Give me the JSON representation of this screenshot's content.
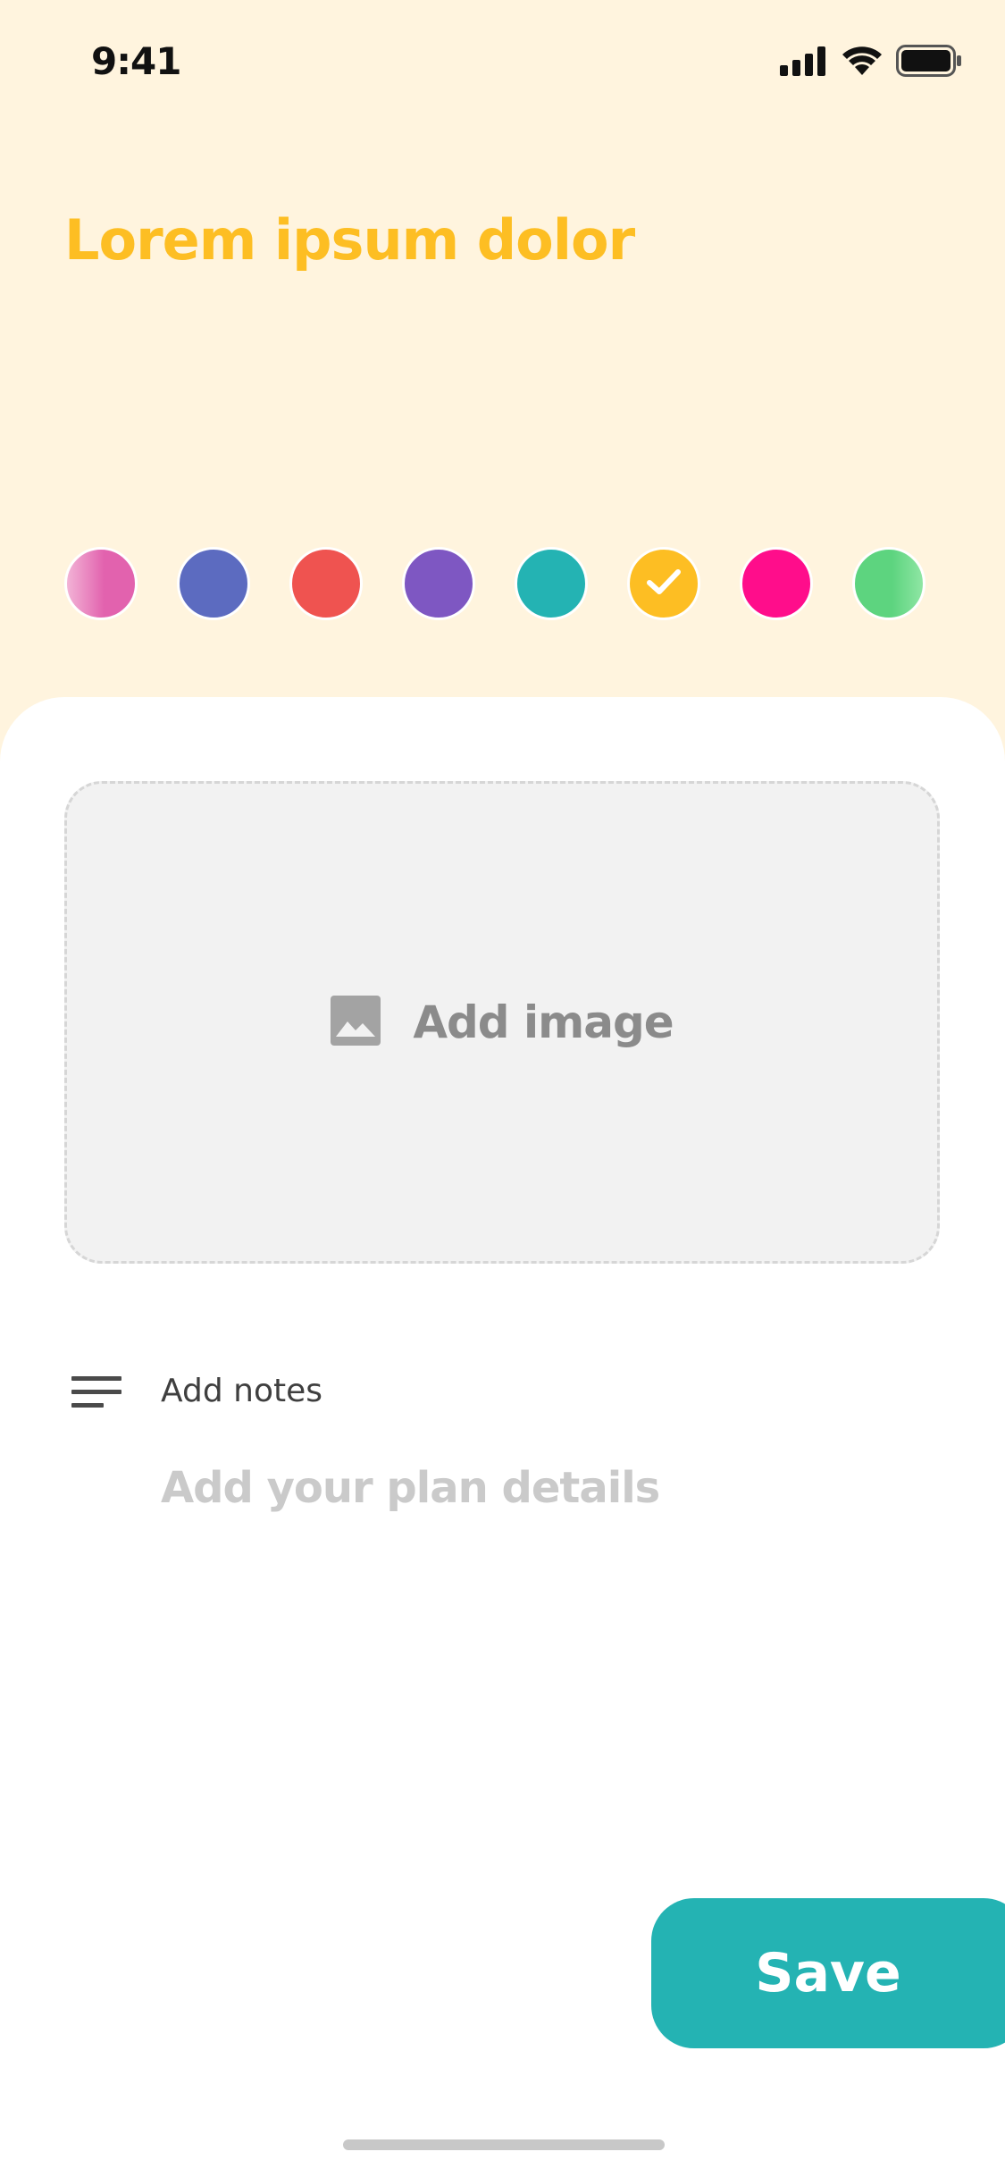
{
  "status_bar": {
    "time": "9:41",
    "signal_icon": "cellular-signal-icon",
    "wifi_icon": "wifi-icon",
    "battery_icon": "battery-icon"
  },
  "header": {
    "title": "Lorem ipsum dolor"
  },
  "color_picker": {
    "selected_index": 5,
    "swatches": [
      {
        "name": "pink",
        "color": "#E262AE",
        "highlight": "#F2B3D6"
      },
      {
        "name": "indigo",
        "color": "#5C6BC0"
      },
      {
        "name": "red",
        "color": "#EF5350"
      },
      {
        "name": "purple",
        "color": "#7E57C2"
      },
      {
        "name": "teal",
        "color": "#24B3B3"
      },
      {
        "name": "amber",
        "color": "#FDBE23"
      },
      {
        "name": "magenta",
        "color": "#FF0D8B"
      },
      {
        "name": "green",
        "color": "#5DD47F",
        "highlight": "#8FE6A4"
      }
    ]
  },
  "image_upload": {
    "label": "Add image",
    "icon": "image-icon"
  },
  "notes": {
    "label": "Add notes",
    "icon": "notes-lines-icon",
    "value": "",
    "placeholder": "Add your plan details"
  },
  "actions": {
    "save_label": "Save"
  },
  "colors": {
    "background": "#FFF4DE",
    "accent": "#FDBE23",
    "primary_button": "#24B3B3"
  }
}
